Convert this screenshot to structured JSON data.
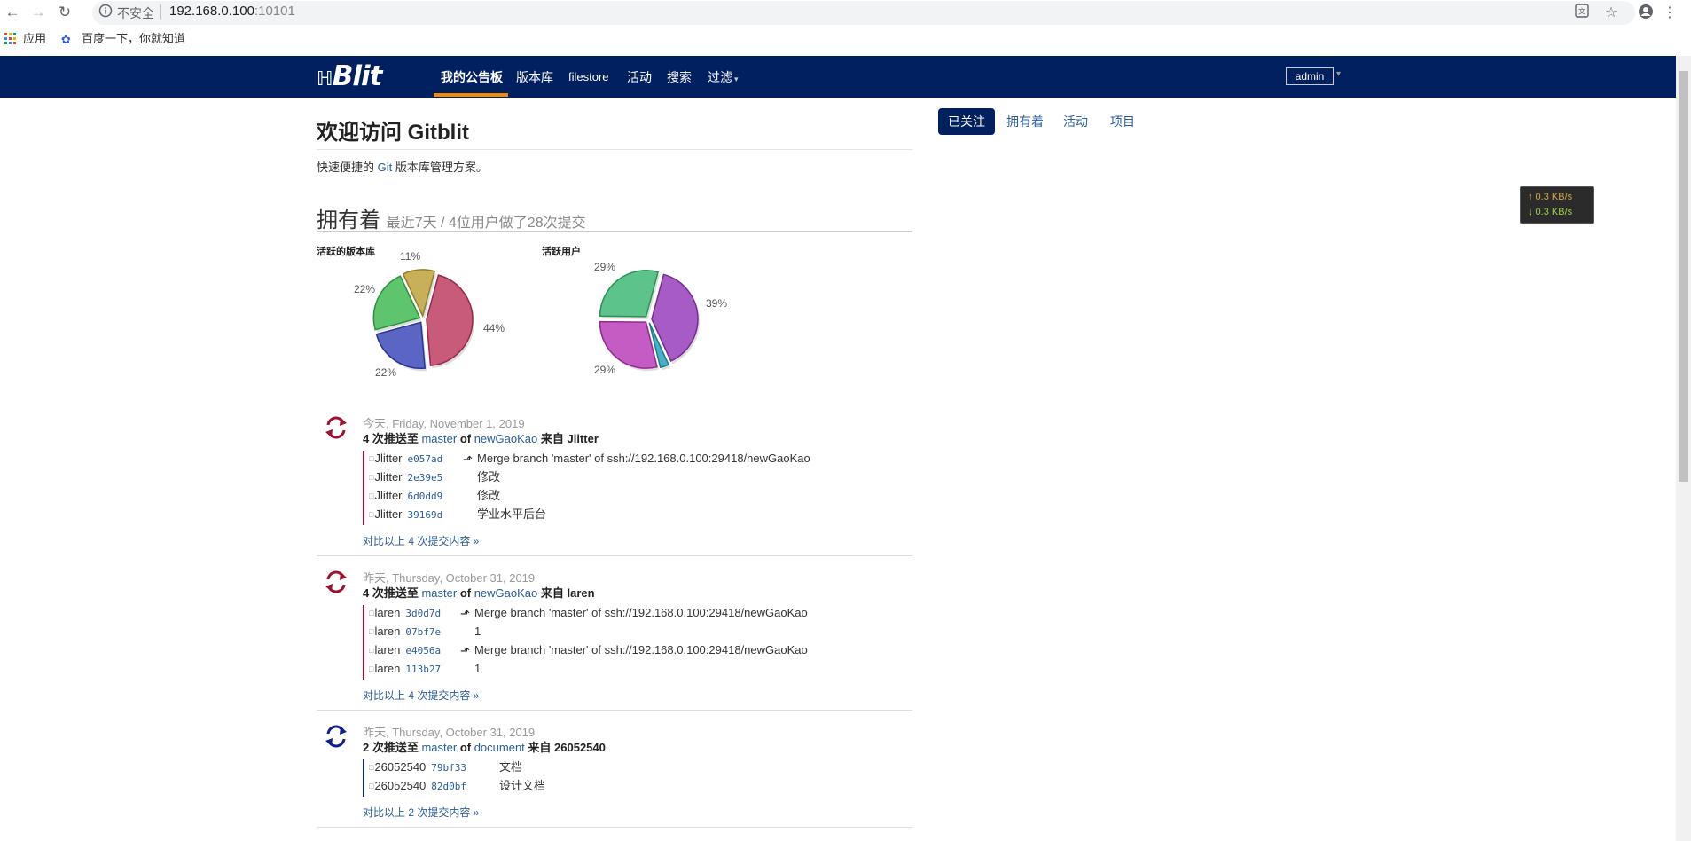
{
  "browser": {
    "security_label": "不安全",
    "url_host": "192.168.0.100",
    "url_port": ":10101",
    "bookmarks": [
      "应用",
      "百度一下，你就知道"
    ]
  },
  "nav": {
    "logo": "Blit",
    "links": [
      "我的公告板",
      "版本库",
      "filestore",
      "活动",
      "搜索",
      "过滤"
    ],
    "user": "admin"
  },
  "right_tabs": [
    "已关注",
    "拥有着",
    "活动",
    "项目"
  ],
  "speed": {
    "up": "↑ 0.3 KB/s",
    "down": "↓ 0.3 KB/s"
  },
  "welcome": {
    "title": "欢迎访问 Gitblit",
    "desc_before": "快速便捷的 ",
    "desc_link": "Git",
    "desc_after": " 版本库管理方案。"
  },
  "owned": {
    "title": "拥有着",
    "subtitle": "最近7天 / 4位用户做了28次提交"
  },
  "chart_data": [
    {
      "type": "pie",
      "title": "活跃的版本库",
      "values": [
        44,
        22,
        22,
        11
      ],
      "labels": [
        "44%",
        "22%",
        "22%",
        "11%"
      ],
      "colors": [
        "#c85a7a",
        "#5b66c4",
        "#5fc46e",
        "#c8b05a"
      ]
    },
    {
      "type": "pie",
      "title": "活跃用户",
      "values": [
        39,
        3,
        29,
        29
      ],
      "labels": [
        "39%",
        "",
        "29%",
        "29%"
      ],
      "colors": [
        "#a65cc4",
        "#4ab0c4",
        "#c45cc4",
        "#5cc48a"
      ]
    }
  ],
  "feed": [
    {
      "date": "今天, Friday, November 1, 2019",
      "count_text": "4 次推送至",
      "branch": "master",
      "of": "of",
      "repo": "newGaoKao",
      "from": "来自",
      "user": "Jlitter",
      "icon_color": "#a01030",
      "commits": [
        {
          "who": "Jlitter",
          "sha": "e057ad",
          "merge": true,
          "msg": "Merge branch 'master' of ssh://192.168.0.100:29418/newGaoKao"
        },
        {
          "who": "Jlitter",
          "sha": "2e39e5",
          "merge": false,
          "msg": "修改"
        },
        {
          "who": "Jlitter",
          "sha": "6d0dd9",
          "merge": false,
          "msg": "修改"
        },
        {
          "who": "Jlitter",
          "sha": "39169d",
          "merge": false,
          "msg": "学业水平后台"
        }
      ],
      "compare": "对比以上 4 次提交内容 »"
    },
    {
      "date": "昨天, Thursday, October 31, 2019",
      "count_text": "4 次推送至",
      "branch": "master",
      "of": "of",
      "repo": "newGaoKao",
      "from": "来自",
      "user": "laren",
      "icon_color": "#a01030",
      "commits": [
        {
          "who": "laren",
          "sha": "3d0d7d",
          "merge": true,
          "msg": "Merge branch 'master' of ssh://192.168.0.100:29418/newGaoKao"
        },
        {
          "who": "laren",
          "sha": "07bf7e",
          "merge": false,
          "msg": "1"
        },
        {
          "who": "laren",
          "sha": "e4056a",
          "merge": true,
          "msg": "Merge branch 'master' of ssh://192.168.0.100:29418/newGaoKao"
        },
        {
          "who": "laren",
          "sha": "113b27",
          "merge": false,
          "msg": "1"
        }
      ],
      "compare": "对比以上 4 次提交内容 »"
    },
    {
      "date": "昨天, Thursday, October 31, 2019",
      "count_text": "2 次推送至",
      "branch": "master",
      "of": "of",
      "repo": "document",
      "from": "来自",
      "user": "26052540",
      "icon_color": "#10208a",
      "commits": [
        {
          "who": "26052540",
          "sha": "79bf33",
          "merge": false,
          "msg": "文档"
        },
        {
          "who": "26052540",
          "sha": "82d0bf",
          "merge": false,
          "msg": "设计文档"
        }
      ],
      "compare": "对比以上 2 次提交内容 »"
    }
  ]
}
